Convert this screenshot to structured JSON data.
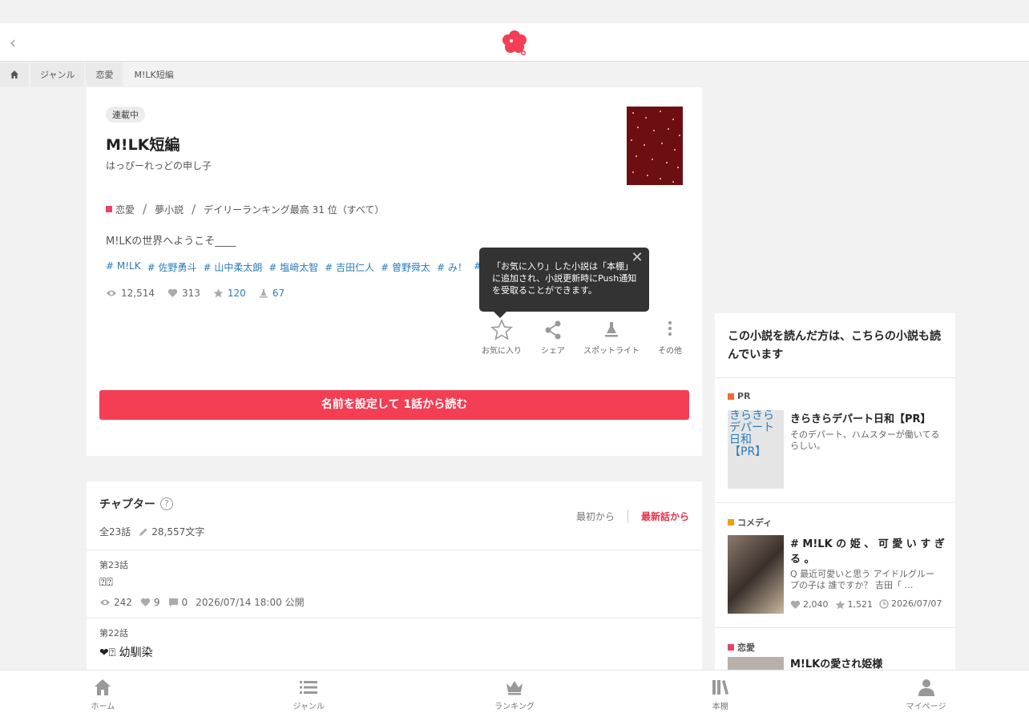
{
  "breadcrumb": {
    "items": [
      "ジャンル",
      "恋愛",
      "M!LK短編"
    ]
  },
  "novel": {
    "status_badge": "連載中",
    "title": "M!LK短編",
    "author": "はっぴーれっどの申し子",
    "genre": "恋愛",
    "category": "夢小説",
    "ranking": "デイリーランキング最高 31 位（すべて）",
    "description": "M!LKの世界へようこそ____",
    "tags": [
      "# M!LK",
      "# 佐野勇斗",
      "# 山中柔太朗",
      "# 塩﨑太智",
      "# 吉田仁人",
      "# 曽野舜太",
      "# み！",
      "# ⍰⍰"
    ],
    "stats": {
      "views": "12,514",
      "likes": "313",
      "favorites": "120",
      "spotlights": "67"
    },
    "actions": {
      "favorite": "お気に入り",
      "share": "シェア",
      "spotlight": "スポットライト",
      "more": "その他"
    },
    "read_button": "名前を設定して 1話から読む",
    "cover_color": "#6d0f12"
  },
  "tooltip": {
    "line1": "「お気に入り」した小説は「本棚」",
    "line2": "に追加され、小説更新時にPush通知",
    "line3": "を受取ることができます。"
  },
  "chapters": {
    "title": "チャプター",
    "total": "全23話",
    "chars": "28,557文字",
    "sort_first": "最初から",
    "sort_latest": "最新話から",
    "episodes": [
      {
        "num": "第23話",
        "title": "⍰⍰",
        "views": "242",
        "likes": "9",
        "comments": "0",
        "date": "2026/07/14 18:00 公開"
      },
      {
        "num": "第22話",
        "title": "❤⍰ 幼馴染",
        "views": "",
        "likes": "",
        "comments": "",
        "date": ""
      }
    ]
  },
  "sidebar": {
    "heading": "この小説を読んだ方は、こちらの小説も読んでいます",
    "recs": [
      {
        "genre": "PR",
        "genre_color": "#f26b2a",
        "thumb_alt": "きらきらデパート日和【PR】",
        "title": "きらきらデパート日和【PR】",
        "desc": "そのデパート、ハムスターが働いてるらしい。"
      },
      {
        "genre": "コメディ",
        "genre_color": "#f39c12",
        "title": "# M!LK の 姫 、 可 愛 い す ぎ る 。",
        "desc": "Q 最近可愛いと思う アイドルグループの子は 誰ですか？ 吉田「 …",
        "likes": "2,040",
        "stars": "1,521",
        "date": "2026/07/07"
      },
      {
        "genre": "恋愛",
        "genre_color": "#e94266",
        "title": "M!LKの愛され姫様"
      }
    ]
  },
  "bottom_nav": {
    "home": "ホーム",
    "genre": "ジャンル",
    "ranking": "ランキング",
    "shelf": "本棚",
    "mypage": "マイページ"
  }
}
